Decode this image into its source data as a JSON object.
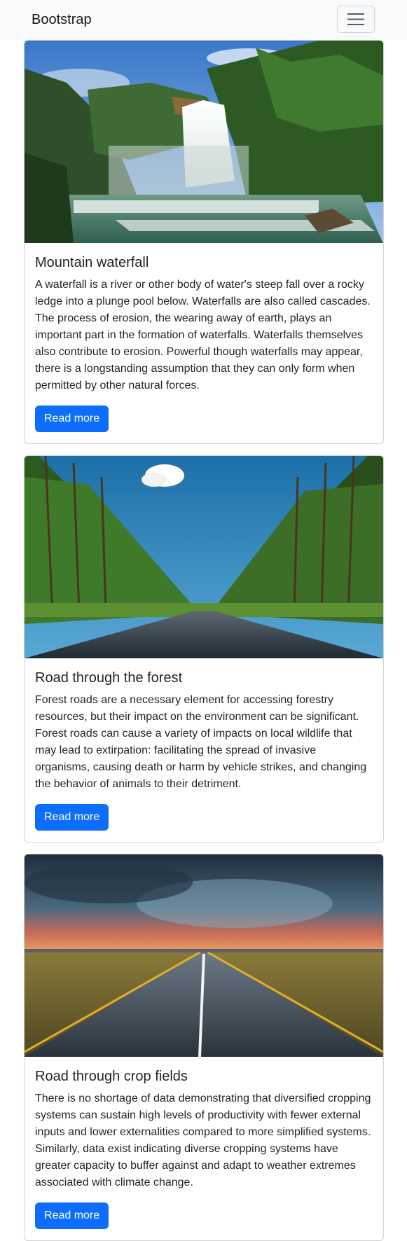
{
  "navbar": {
    "brand": "Bootstrap",
    "toggler_icon": "hamburger-menu-icon"
  },
  "cards": [
    {
      "image": "mountain-waterfall-photo",
      "title": "Mountain waterfall",
      "text": "A waterfall is a river or other body of water's steep fall over a rocky ledge into a plunge pool below. Waterfalls are also called cascades. The process of erosion, the wearing away of earth, plays an important part in the formation of waterfalls. Waterfalls themselves also contribute to erosion. Powerful though waterfalls may appear, there is a longstanding assumption that they can only form when permitted by other natural forces.",
      "button": "Read more"
    },
    {
      "image": "forest-road-photo",
      "title": "Road through the forest",
      "text": "Forest roads are a necessary element for accessing forestry resources, but their impact on the environment can be significant. Forest roads can cause a variety of impacts on local wildlife that may lead to extirpation: facilitating the spread of invasive organisms, causing death or harm by vehicle strikes, and changing the behavior of animals to their detriment.",
      "button": "Read more"
    },
    {
      "image": "crop-fields-road-photo",
      "title": "Road through crop fields",
      "text": "There is no shortage of data demonstrating that diversified cropping systems can sustain high levels of productivity with fewer external inputs and lower externalities compared to more simplified systems. Similarly, data exist indicating diverse cropping systems have greater capacity to buffer against and adapt to weather extremes associated with climate change.",
      "button": "Read more"
    }
  ],
  "colors": {
    "navbar_bg": "#f8f9fa",
    "primary": "#0d6efd",
    "text": "#212529"
  }
}
